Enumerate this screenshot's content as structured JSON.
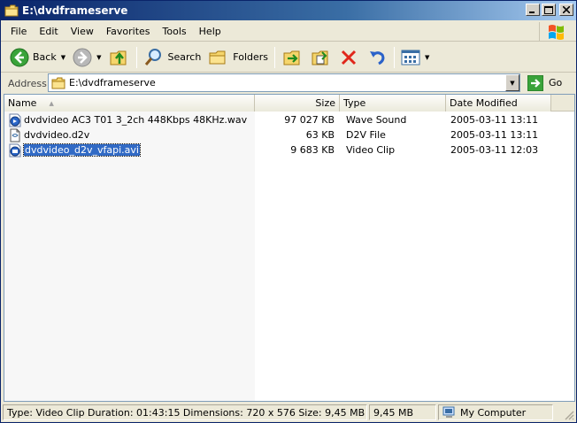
{
  "window": {
    "title": "E:\\dvdframeserve",
    "title_icon": "folder-icon",
    "controls": [
      "minimize",
      "maximize",
      "close"
    ]
  },
  "menu": [
    {
      "label": "File",
      "accel": "F"
    },
    {
      "label": "Edit",
      "accel": "E"
    },
    {
      "label": "View",
      "accel": "V"
    },
    {
      "label": "Favorites",
      "accel": "a"
    },
    {
      "label": "Tools",
      "accel": "T"
    },
    {
      "label": "Help",
      "accel": "H"
    }
  ],
  "toolbar": {
    "back_label": "Back",
    "search_label": "Search",
    "folders_label": "Folders"
  },
  "address": {
    "label": "Address",
    "value": "E:\\dvdframeserve",
    "go_label": "Go"
  },
  "columns": {
    "name": "Name",
    "size": "Size",
    "type": "Type",
    "date": "Date Modified"
  },
  "files": [
    {
      "name": "dvdvideo AC3 T01 3_2ch 448Kbps 48KHz.wav",
      "size": "97 027 KB",
      "type": "Wave Sound",
      "date": "2005-03-11 13:11",
      "icon": "audio-file-icon",
      "selected": false
    },
    {
      "name": "dvdvideo.d2v",
      "size": "63 KB",
      "type": "D2V File",
      "date": "2005-03-11 13:11",
      "icon": "generic-file-icon",
      "selected": false
    },
    {
      "name": "dvdvideo_d2v_vfapi.avi",
      "size": "9 683 KB",
      "type": "Video Clip",
      "date": "2005-03-11 12:03",
      "icon": "video-file-icon",
      "selected": true
    }
  ],
  "status": {
    "info": "Type: Video Clip Duration: 01:43:15 Dimensions: 720 x 576 Size: 9,45 MB",
    "size": "9,45 MB",
    "location": "My Computer"
  },
  "colors": {
    "selection": "#316ac5",
    "title_gradient_start": "#0a246a",
    "chrome": "#ece9d8"
  }
}
